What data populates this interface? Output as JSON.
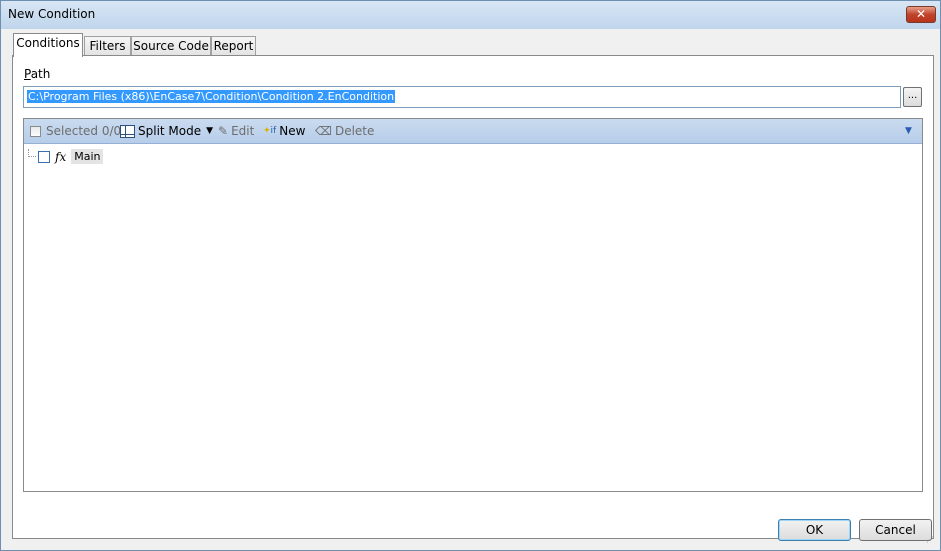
{
  "window": {
    "title": "New Condition",
    "close_label": "✕"
  },
  "tabs": [
    {
      "label": "Conditions",
      "active": true
    },
    {
      "label": "Filters",
      "active": false
    },
    {
      "label": "Source Code",
      "active": false
    },
    {
      "label": "Report",
      "active": false
    }
  ],
  "path": {
    "label_first": "P",
    "label_rest": "ath",
    "value": "C:\\Program Files (x86)\\EnCase7\\Condition\\Condition 2.EnCondition",
    "browse_label": "..."
  },
  "toolbar": {
    "selected_label": "Selected 0/0",
    "split_mode_label": "Split Mode",
    "edit_label": "Edit",
    "new_prefix": "if",
    "new_label": "New",
    "delete_label": "Delete"
  },
  "tree": {
    "fx_symbol": "fx",
    "root_label": "Main"
  },
  "footer": {
    "ok_label": "OK",
    "cancel_label": "Cancel"
  },
  "colors": {
    "selection": "#3399ff",
    "toolbar": "#c3d7ef",
    "close": "#c0432b"
  }
}
